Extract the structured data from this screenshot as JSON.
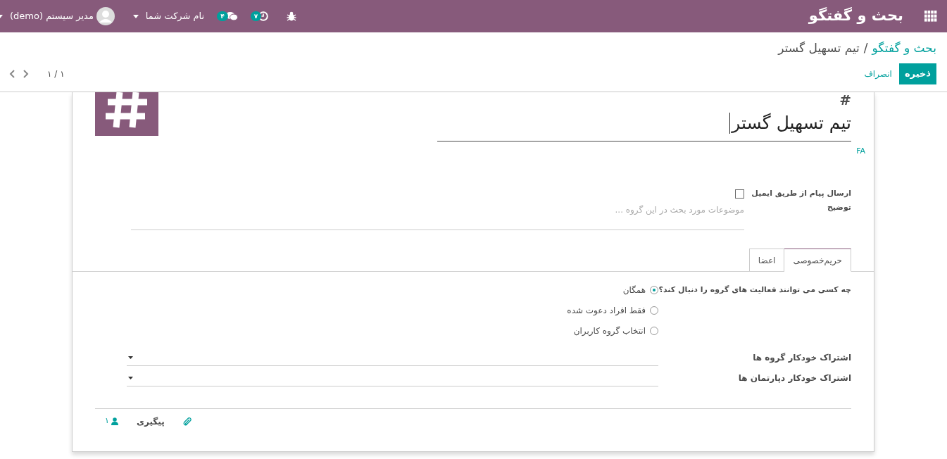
{
  "navbar": {
    "app_title": "بحث و گفتگو",
    "activities_count": "۷",
    "messages_count": "۴",
    "company": "نام شرکت شما",
    "user": "مدیر سیستم (demo)"
  },
  "breadcrumb": {
    "parent": "بحث و گفتگو",
    "separator": "/",
    "current": "تیم تسهیل گستر"
  },
  "buttons": {
    "save": "ذخیره",
    "discard": "انصراف"
  },
  "pager": "۱ / ۱",
  "form": {
    "name_prefix": "#",
    "name": "تیم تسهیل گستر",
    "language": "FA",
    "email_label": "ارسال پیام از طریق ایمیل",
    "email_checked": false,
    "description_label": "توضیح",
    "description_placeholder": "موضوعات مورد بحث در این گروه ...",
    "tabs": [
      {
        "label": "حریم‌خصوصی",
        "selected": true
      },
      {
        "label": "اعضا",
        "selected": false
      }
    ],
    "privacy_label": "چه کسی می توانند فعالیت های گروه را دنبال کند؟",
    "privacy_options": [
      {
        "label": "همگان",
        "selected": true
      },
      {
        "label": "فقط افراد دعوت شده",
        "selected": false
      },
      {
        "label": "انتخاب گروه کاربران",
        "selected": false
      }
    ],
    "auto_subscribe": [
      {
        "label": "اشتراک خودکار گروه ها"
      },
      {
        "label": "اشتراک خودکار دپارتمان ها"
      }
    ]
  },
  "chatter": {
    "follow": "پیگیری",
    "followers_count": "۱"
  }
}
